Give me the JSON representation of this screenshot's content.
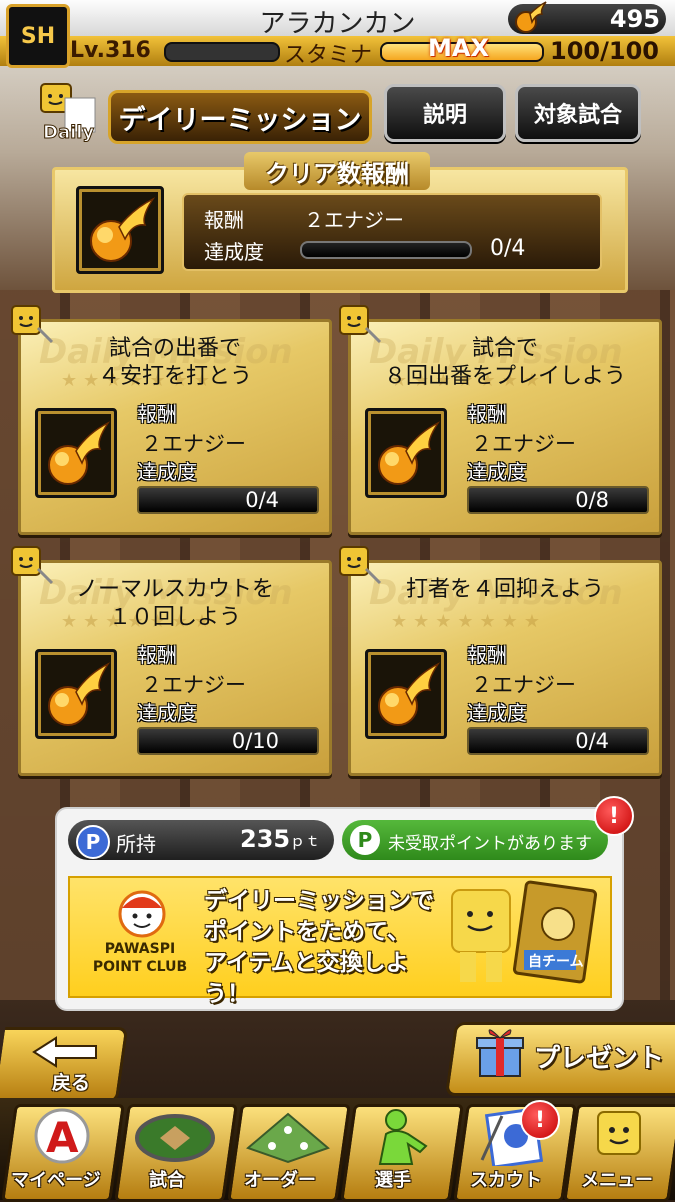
{
  "header": {
    "logo_text": "SH",
    "username": "アラカンカン",
    "energy": "495",
    "level_prefix": "Lv.",
    "level": "316",
    "stamina_label": "スタミナ",
    "stamina_status": "MAX",
    "stamina_value": "100/100"
  },
  "title": {
    "badge": "Daily",
    "heading": "デイリーミッション",
    "help_button": "説明",
    "target_games_button": "対象試合"
  },
  "clear_reward": {
    "heading": "クリア数報酬",
    "reward_label": "報酬",
    "reward_value": "２エナジー",
    "progress_label": "達成度",
    "progress_text": "0/4",
    "progress_fraction": 0
  },
  "missions": [
    {
      "title_line1": "試合の出番で",
      "title_line2": "４安打を打とう",
      "reward_label": "報酬",
      "reward_value": "２エナジー",
      "progress_label": "達成度",
      "progress_text": "0/4",
      "watermark": "Daily Mission"
    },
    {
      "title_line1": "試合で",
      "title_line2": "８回出番をプレイしよう",
      "reward_label": "報酬",
      "reward_value": "２エナジー",
      "progress_label": "達成度",
      "progress_text": "0/8",
      "watermark": "Daily Mission"
    },
    {
      "title_line1": "ノーマルスカウトを",
      "title_line2": "１０回しよう",
      "reward_label": "報酬",
      "reward_value": "２エナジー",
      "progress_label": "達成度",
      "progress_text": "0/10",
      "watermark": "Daily Mission"
    },
    {
      "title_line1": "打者を４回抑えよう",
      "title_line2": "",
      "reward_label": "報酬",
      "reward_value": "２エナジー",
      "progress_label": "達成度",
      "progress_text": "0/4",
      "watermark": "Daily Mission"
    }
  ],
  "points": {
    "owned_label": "所持",
    "owned_value": "235",
    "owned_unit": "ｐｔ",
    "unclaimed_text": "未受取ポイントがあります",
    "club_line1": "PAWASPI",
    "club_line2": "POINT CLUB",
    "banner_line1": "デイリーミッションで",
    "banner_line2": "ポイントをためて、",
    "banner_line3": "アイテムと交換しよう！",
    "card_label": "自チーム"
  },
  "actions": {
    "back": "戻る",
    "present": "プレゼント"
  },
  "nav": [
    {
      "label": "マイページ"
    },
    {
      "label": "試合"
    },
    {
      "label": "オーダー"
    },
    {
      "label": "選手"
    },
    {
      "label": "スカウト"
    },
    {
      "label": "メニュー"
    }
  ],
  "colors": {
    "gold": "#d9a22a",
    "alert_red": "#c40000",
    "point_green": "#2f8a1b"
  }
}
